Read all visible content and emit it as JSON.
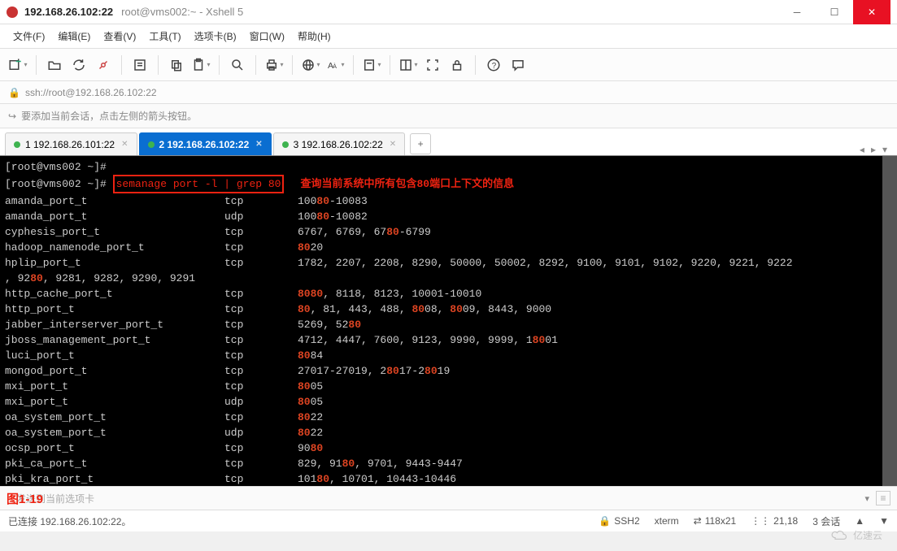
{
  "title": {
    "host": "192.168.26.102:22",
    "rest": "root@vms002:~ - Xshell 5"
  },
  "menu": {
    "file": "文件(F)",
    "edit": "编辑(E)",
    "view": "查看(V)",
    "tools": "工具(T)",
    "tabs": "选项卡(B)",
    "window": "窗口(W)",
    "help": "帮助(H)"
  },
  "address": "ssh://root@192.168.26.102:22",
  "hint": "要添加当前会话，点击左侧的箭头按钮。",
  "tabs": [
    {
      "label": "1 192.168.26.101:22"
    },
    {
      "label": "2 192.168.26.102:22"
    },
    {
      "label": "3 192.168.26.102:22"
    }
  ],
  "terminal": {
    "prompt1": "[root@vms002 ~]#",
    "prompt2": "[root@vms002 ~]# ",
    "command": "semanage port -l | grep 80",
    "annotation": "查询当前系统中所有包含80端口上下文的信息",
    "rows": [
      {
        "name": "amanda_port_t",
        "proto": "tcp",
        "ports": [
          [
            "100"
          ],
          [
            "80",
            true
          ],
          [
            "-10083"
          ]
        ]
      },
      {
        "name": "amanda_port_t",
        "proto": "udp",
        "ports": [
          [
            "100"
          ],
          [
            "80",
            true
          ],
          [
            "-10082"
          ]
        ]
      },
      {
        "name": "cyphesis_port_t",
        "proto": "tcp",
        "ports": [
          [
            "6767, 6769, 67"
          ],
          [
            "80",
            true
          ],
          [
            "-6799"
          ]
        ]
      },
      {
        "name": "hadoop_namenode_port_t",
        "proto": "tcp",
        "ports": [
          [
            "80",
            true
          ],
          [
            "20"
          ]
        ]
      },
      {
        "name": "hplip_port_t",
        "proto": "tcp",
        "ports": [
          [
            "1782, 2207, 2208, 8290, 50000, 50002, 8292, 9100, 9101, 9102, 9220, 9221, 9222"
          ]
        ]
      }
    ],
    "wrapline": [
      [
        ", 92"
      ],
      [
        "80",
        true
      ],
      [
        ", 9281, 9282, 9290, 9291"
      ]
    ],
    "rows2": [
      {
        "name": "http_cache_port_t",
        "proto": "tcp",
        "ports": [
          [
            "8080",
            true
          ],
          [
            ", 8118, 8123, 10001-10010"
          ]
        ]
      },
      {
        "name": "http_port_t",
        "proto": "tcp",
        "ports": [
          [
            "80",
            true
          ],
          [
            ", 81, 443, 488, "
          ],
          [
            "80",
            true
          ],
          [
            "08, "
          ],
          [
            "80",
            true
          ],
          [
            "09, 8443, 9000"
          ]
        ]
      },
      {
        "name": "jabber_interserver_port_t",
        "proto": "tcp",
        "ports": [
          [
            "5269, 52"
          ],
          [
            "80",
            true
          ]
        ]
      },
      {
        "name": "jboss_management_port_t",
        "proto": "tcp",
        "ports": [
          [
            "4712, 4447, 7600, 9123, 9990, 9999, 1"
          ],
          [
            "80",
            true
          ],
          [
            "01"
          ]
        ]
      },
      {
        "name": "luci_port_t",
        "proto": "tcp",
        "ports": [
          [
            "80",
            true
          ],
          [
            "84"
          ]
        ]
      },
      {
        "name": "mongod_port_t",
        "proto": "tcp",
        "ports": [
          [
            "27017-27019, 2"
          ],
          [
            "80",
            true
          ],
          [
            "17-2"
          ],
          [
            "80",
            true
          ],
          [
            "19"
          ]
        ]
      },
      {
        "name": "mxi_port_t",
        "proto": "tcp",
        "ports": [
          [
            "80",
            true
          ],
          [
            "05"
          ]
        ]
      },
      {
        "name": "mxi_port_t",
        "proto": "udp",
        "ports": [
          [
            "80",
            true
          ],
          [
            "05"
          ]
        ]
      },
      {
        "name": "oa_system_port_t",
        "proto": "tcp",
        "ports": [
          [
            "80",
            true
          ],
          [
            "22"
          ]
        ]
      },
      {
        "name": "oa_system_port_t",
        "proto": "udp",
        "ports": [
          [
            "80",
            true
          ],
          [
            "22"
          ]
        ]
      },
      {
        "name": "ocsp_port_t",
        "proto": "tcp",
        "ports": [
          [
            "90"
          ],
          [
            "80",
            true
          ]
        ]
      },
      {
        "name": "pki_ca_port_t",
        "proto": "tcp",
        "ports": [
          [
            "829, 91"
          ],
          [
            "80",
            true
          ],
          [
            ", 9701, 9443-9447"
          ]
        ]
      },
      {
        "name": "pki_kra_port_t",
        "proto": "tcp",
        "ports": [
          [
            "101"
          ],
          [
            "80",
            true
          ],
          [
            ", 10701, 10443-10446"
          ]
        ]
      }
    ]
  },
  "figlabel": "图1-19",
  "cmdinput_placeholder": "发送到当前选项卡",
  "status": {
    "conn": "已连接 192.168.26.102:22。",
    "proto": "SSH2",
    "term": "xterm",
    "size": "118x21",
    "pos": "21,18",
    "sessions": "3 会话"
  },
  "watermark": "亿速云"
}
